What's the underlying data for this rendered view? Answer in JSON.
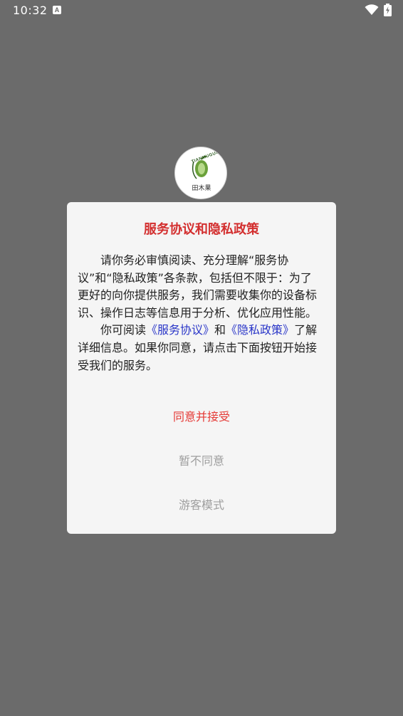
{
  "status_bar": {
    "time": "10:32",
    "notification_icon": "a-icon",
    "wifi_icon": "wifi-icon",
    "battery_icon": "battery-charging-icon"
  },
  "splash": {
    "logo_brand": "TIANMUGUO",
    "logo_text": "田木果",
    "logo_icon": "fruit-logo-icon"
  },
  "dialog": {
    "title": "服务协议和隐私政策",
    "paragraph1": "请你务必审慎阅读、充分理解“服务协议”和“隐私政策”各条款，包括但不限于：为了更好的向你提供服务，我们需要收集你的设备标识、操作日志等信息用于分析、优化应用性能。",
    "paragraph2_prefix": "你可阅读",
    "service_agreement_link": "《服务协议》",
    "paragraph2_and": "和",
    "privacy_policy_link": "《隐私政策》",
    "paragraph2_suffix": "了解详细信息。如果你同意，请点击下面按钮开始接受我们的服务。",
    "agree_label": "同意并接受",
    "disagree_label": "暂不同意",
    "guest_label": "游客模式"
  },
  "colors": {
    "overlay": "#6b6b6b",
    "title": "#d32f2f",
    "agree": "#e53935",
    "link": "#2a36c8",
    "secondary": "#9e9e9e"
  }
}
